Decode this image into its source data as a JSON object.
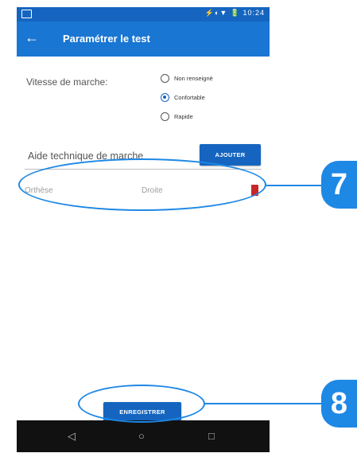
{
  "status_bar": {
    "right_text": "⚡◐▼ 🔋 10:24"
  },
  "app_bar": {
    "back_icon": "arrow-left-icon",
    "title": "Paramétrer le test"
  },
  "walking_speed": {
    "label": "Vitesse de marche:",
    "options": [
      {
        "label": "Non renseigné",
        "selected": false
      },
      {
        "label": "Confortable",
        "selected": true
      },
      {
        "label": "Rapide",
        "selected": false
      }
    ]
  },
  "walking_aid": {
    "label": "Aide technique de marche",
    "add_button": "AJOUTER",
    "rows": [
      {
        "type": "Orthèse",
        "side": "Droite",
        "delete_icon": "trash-icon"
      }
    ]
  },
  "save_button": "ENREGISTRER",
  "nav_bar": {
    "back_icon": "◁",
    "home_icon": "○",
    "recent_icon": "□"
  },
  "callouts": {
    "first": "7",
    "second": "8"
  },
  "colors": {
    "accent": "#1976d2",
    "callout": "#1e88e5",
    "delete": "#c62828"
  }
}
